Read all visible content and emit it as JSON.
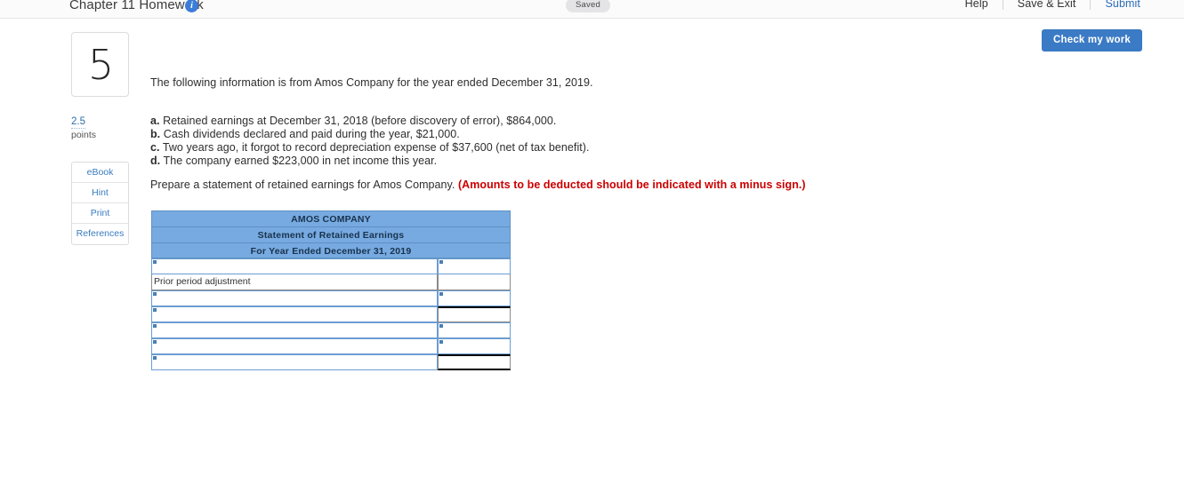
{
  "topbar": {
    "title": "Chapter 11 Homework",
    "info_icon": "info-icon",
    "saved_label": "Saved",
    "nav": [
      {
        "label": "Help"
      },
      {
        "label": "Save & Exit"
      },
      {
        "label": "Submit"
      }
    ]
  },
  "actions": {
    "check_my_work": "Check my work"
  },
  "question": {
    "number": "5",
    "points_value": "2.5",
    "points_label": "points",
    "tools": [
      {
        "label": "eBook"
      },
      {
        "label": "Hint"
      },
      {
        "label": "Print"
      },
      {
        "label": "References"
      }
    ],
    "intro": "The following information is from Amos Company for the year ended December 31, 2019.",
    "facts": [
      {
        "letter": "a.",
        "text": "Retained earnings at December 31, 2018 (before discovery of error), $864,000."
      },
      {
        "letter": "b.",
        "text": "Cash dividends declared and paid during the year, $21,000."
      },
      {
        "letter": "c.",
        "text": "Two years ago, it forgot to record depreciation expense of $37,600 (net of tax benefit)."
      },
      {
        "letter": "d.",
        "text": "The company earned $223,000 in net income this year."
      }
    ],
    "prompt_main": "Prepare a statement of retained earnings for Amos Company.",
    "prompt_warning": "(Amounts to be deducted should be indicated with a minus sign.)"
  },
  "worksheet": {
    "header_lines": [
      "AMOS COMPANY",
      "Statement of Retained Earnings",
      "For Year Ended December 31, 2019"
    ],
    "rows": [
      {
        "left_type": "input",
        "left_value": "",
        "right_type": "input",
        "right_value": ""
      },
      {
        "left_type": "label",
        "left_value": "Prior period adjustment",
        "right_type": "plain",
        "right_value": ""
      },
      {
        "left_type": "input",
        "left_value": "",
        "right_type": "input",
        "right_value": ""
      },
      {
        "left_type": "input",
        "left_value": "",
        "right_type": "ruled",
        "right_value": ""
      },
      {
        "left_type": "input",
        "left_value": "",
        "right_type": "input",
        "right_value": ""
      },
      {
        "left_type": "input",
        "left_value": "",
        "right_type": "input",
        "right_value": ""
      },
      {
        "left_type": "input",
        "left_value": "",
        "right_type": "ruled-bottom",
        "right_value": ""
      }
    ]
  }
}
